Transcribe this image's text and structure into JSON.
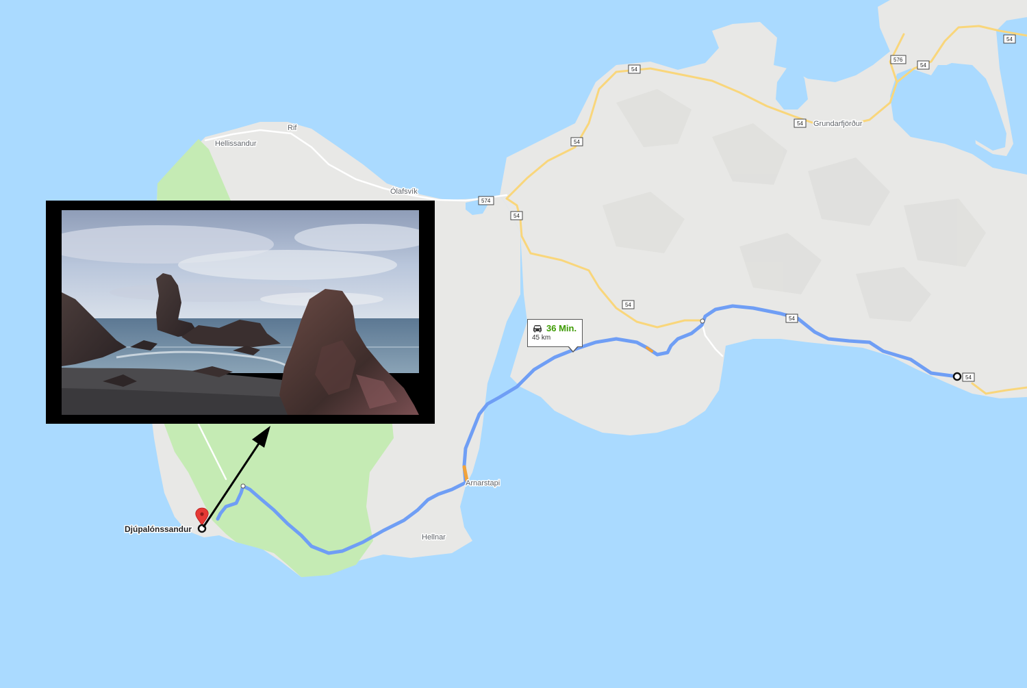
{
  "map": {
    "colors": {
      "water": "#aadaff",
      "land": "#e8e8e6",
      "park": "#c5ebb4",
      "highway": "#f9d67b",
      "route": "#6f9ef5",
      "route_delay": "#f2a33a",
      "destination_pin": "#e53935"
    },
    "places": {
      "rif": "Rif",
      "hellissandur": "Hellissandur",
      "olafsvik": "Ólafsvík",
      "grundarfjordur": "Grundarfjörður",
      "arnarstapi": "Arnarstapi",
      "hellnar": "Hellnar",
      "destination": "Djúpalónssandur"
    },
    "shields": {
      "s1": "54",
      "s2": "54",
      "s3": "54",
      "s4": "54",
      "s5": "54",
      "s6": "54",
      "s7": "54",
      "s8": "54",
      "s574": "574",
      "s576": "576"
    },
    "route_info": {
      "icon": "car-icon",
      "duration": "36 Min.",
      "distance": "45 km"
    },
    "photo": {
      "subject": "beach-rock-formations-photo"
    }
  }
}
